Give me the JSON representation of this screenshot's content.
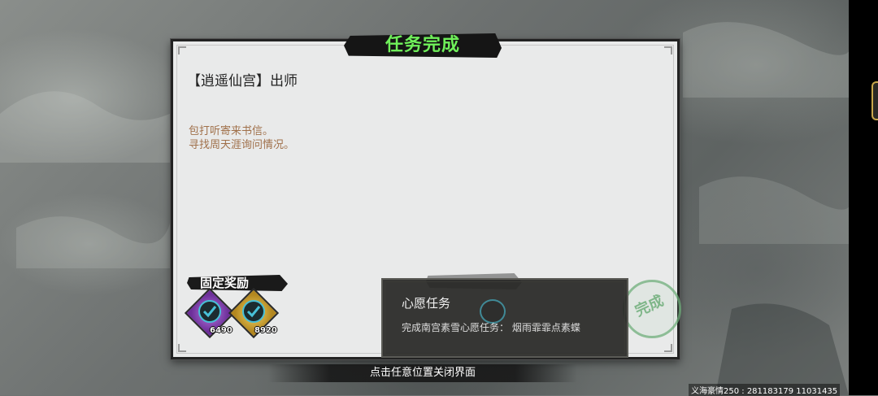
{
  "dialog": {
    "title": "任务完成",
    "quest_name": "【逍遥仙宫】出师",
    "description_lines": [
      "包打听寄来书信。",
      "寻找周天涯询问情况。"
    ],
    "fixed_reward_label": "固定奖励",
    "rewards": [
      {
        "icon": "purple-exp-token-icon",
        "count": "6490"
      },
      {
        "icon": "gold-exp-token-icon",
        "count": "8920"
      }
    ],
    "stamp_text": "完成"
  },
  "tooltip": {
    "title": "心愿任务",
    "body": "完成南宫素雪心愿任务：   烟雨霏霏点素蝶"
  },
  "footer": {
    "close_hint": "点击任意位置关闭界面",
    "watermark": "义海豪情250 : 281183179  11031435"
  },
  "colors": {
    "title_green": "#6ff05a",
    "description_brown": "#a0704a",
    "check_cyan": "#48c0d8",
    "stamp_green": "#6fae7a"
  }
}
